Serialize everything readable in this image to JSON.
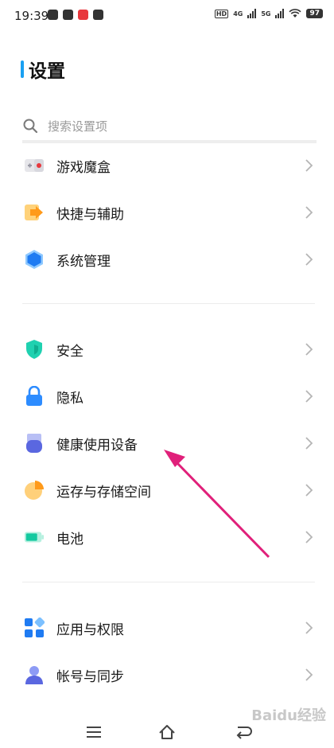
{
  "status_bar": {
    "time": "19:39",
    "signal1_label": "4G",
    "signal2_label": "5G",
    "hd_label": "HD",
    "battery": "97"
  },
  "header": {
    "title": "设置"
  },
  "search": {
    "placeholder": "搜索设置项"
  },
  "groups": [
    {
      "items": [
        {
          "label": "游戏魔盒",
          "icon": "gamepad-icon"
        },
        {
          "label": "快捷与辅助",
          "icon": "shortcut-arrow-icon"
        },
        {
          "label": "系统管理",
          "icon": "hexagon-system-icon"
        }
      ]
    },
    {
      "items": [
        {
          "label": "安全",
          "icon": "shield-icon"
        },
        {
          "label": "隐私",
          "icon": "lock-icon"
        },
        {
          "label": "健康使用设备",
          "icon": "health-device-icon"
        },
        {
          "label": "运存与存储空间",
          "icon": "storage-pie-icon"
        },
        {
          "label": "电池",
          "icon": "battery-icon"
        }
      ]
    },
    {
      "items": [
        {
          "label": "应用与权限",
          "icon": "apps-grid-icon"
        },
        {
          "label": "帐号与同步",
          "icon": "account-user-icon"
        }
      ]
    }
  ],
  "watermark": "Baidu经验",
  "colors": {
    "accent": "#1aa0f2",
    "annotation_arrow": "#e0207a"
  }
}
